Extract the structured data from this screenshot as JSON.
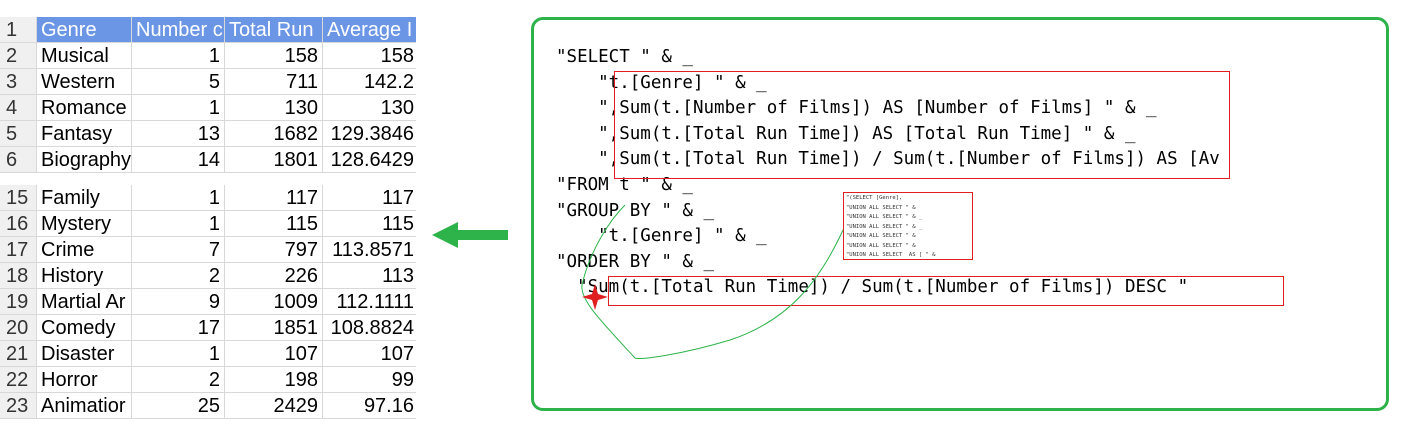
{
  "sheet": {
    "headers": [
      "Genre",
      "Number of Films",
      "Total Run Time",
      "Average Run Time"
    ],
    "header_display": [
      "Genre",
      "Number c",
      "Total Run",
      "Average I"
    ],
    "top_rows": [
      {
        "n": "1"
      },
      {
        "n": "2",
        "g": "Musical",
        "a": "1",
        "b": "158",
        "c": "158"
      },
      {
        "n": "3",
        "g": "Western",
        "a": "5",
        "b": "711",
        "c": "142.2"
      },
      {
        "n": "4",
        "g": "Romance",
        "a": "1",
        "b": "130",
        "c": "130"
      },
      {
        "n": "5",
        "g": "Fantasy",
        "a": "13",
        "b": "1682",
        "c": "129.3846"
      },
      {
        "n": "6",
        "g": "Biography",
        "a": "14",
        "b": "1801",
        "c": "128.6429"
      }
    ],
    "bottom_rows": [
      {
        "n": "15",
        "g": "Family",
        "a": "1",
        "b": "117",
        "c": "117"
      },
      {
        "n": "16",
        "g": "Mystery",
        "a": "1",
        "b": "115",
        "c": "115"
      },
      {
        "n": "17",
        "g": "Crime",
        "a": "7",
        "b": "797",
        "c": "113.8571"
      },
      {
        "n": "18",
        "g": "History",
        "a": "2",
        "b": "226",
        "c": "113"
      },
      {
        "n": "19",
        "g": "Martial Ar",
        "a": "9",
        "b": "1009",
        "c": "112.1111"
      },
      {
        "n": "20",
        "g": "Comedy",
        "a": "17",
        "b": "1851",
        "c": "108.8824"
      },
      {
        "n": "21",
        "g": "Disaster",
        "a": "1",
        "b": "107",
        "c": "107"
      },
      {
        "n": "22",
        "g": "Horror",
        "a": "2",
        "b": "198",
        "c": "99"
      },
      {
        "n": "23",
        "g": "Animatior",
        "a": "25",
        "b": "2429",
        "c": "97.16"
      }
    ]
  },
  "code": {
    "lines": [
      "\"SELECT \" & _",
      "    \"t.[Genre] \" & _",
      "    \",Sum(t.[Number of Films]) AS [Number of Films] \" & _",
      "    \",Sum(t.[Total Run Time]) AS [Total Run Time] \" & _",
      "    \",Sum(t.[Total Run Time]) / Sum(t.[Number of Films]) AS [Av",
      "\"FROM t \" & _",
      "\"GROUP BY \" & _",
      "    \"t.[Genre] \" & _",
      "\"ORDER BY \" & _",
      "  \"Sum(t.[Total Run Time]) / Sum(t.[Number of Films]) DESC \""
    ],
    "thumbnail": "\"(SELECT [Genre],\n\"UNION ALL SELECT \" &\n\"UNION ALL SELECT \" & _\n\"UNION ALL SELECT \" & _\n\"UNION ALL SELECT \" &\n\"UNION ALL SELECT \" &\n\"UNION ALL SELECT  AS [ \" &"
  },
  "colors": {
    "accent_green": "#2db34a",
    "highlight_red": "#e02020",
    "header_blue": "#6b96e6"
  }
}
